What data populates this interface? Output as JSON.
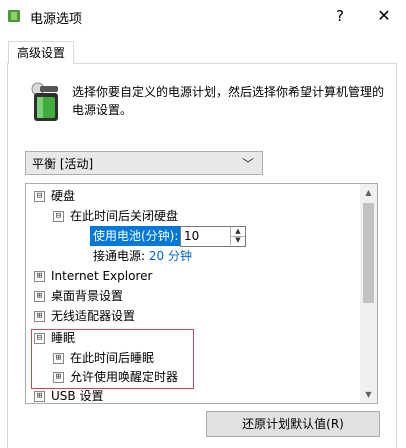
{
  "window": {
    "title": "电源选项",
    "help_glyph": "?",
    "close_glyph": "✕"
  },
  "tabs": [
    {
      "label": "高级设置"
    }
  ],
  "description": "选择你要自定义的电源计划，然后选择你希望计算机管理的电源设置。",
  "plan_dropdown": {
    "selected": "平衡 [活动]"
  },
  "tree": {
    "items": [
      {
        "label": "硬盘",
        "expander": "⊟"
      },
      {
        "label": "在此时间后关闭硬盘",
        "expander": "⊟"
      },
      {
        "label": "使用电池(分钟):",
        "value": "10"
      },
      {
        "label": "接通电源:",
        "value": "20 分钟"
      },
      {
        "label": "Internet Explorer",
        "expander": "⊞"
      },
      {
        "label": "桌面背景设置",
        "expander": "⊞"
      },
      {
        "label": "无线适配器设置",
        "expander": "⊞"
      },
      {
        "label": "睡眠",
        "expander": "⊟"
      },
      {
        "label": "在此时间后睡眠",
        "expander": "⊞"
      },
      {
        "label": "允许使用唤醒定时器",
        "expander": "⊞"
      },
      {
        "label": "USB 设置",
        "expander": "⊞"
      }
    ]
  },
  "buttons": {
    "restore_defaults": "还原计划默认值(R)"
  },
  "colors": {
    "selection": "#0078d7",
    "link_value": "#0066cc",
    "highlight_border": "#c0504d"
  }
}
